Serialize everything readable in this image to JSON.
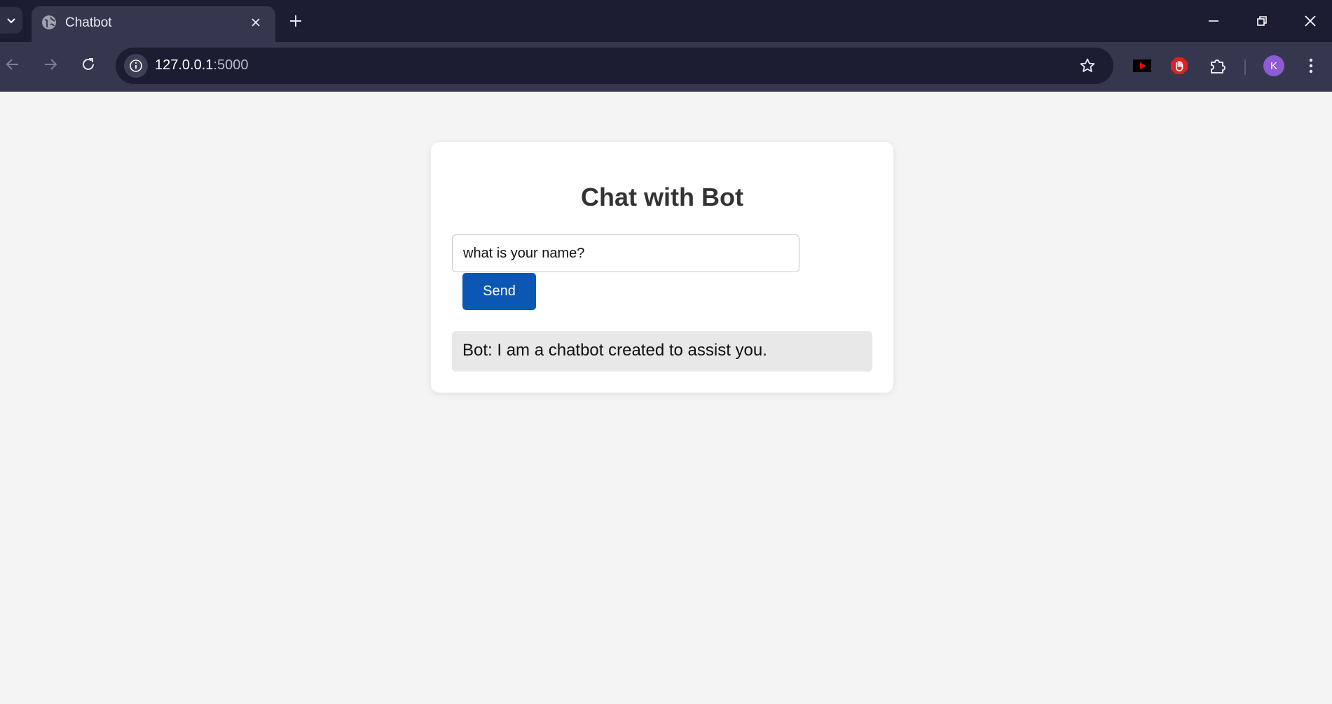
{
  "browser": {
    "tab": {
      "title": "Chatbot",
      "favicon": "globe-icon"
    },
    "address_bar": {
      "host": "127.0.0.1",
      "port": ":5000"
    },
    "profile_initial": "K",
    "colors": {
      "tabstrip": "#1c1d33",
      "toolbar": "#35374f",
      "avatar": "#8e5bd3"
    }
  },
  "chat": {
    "title": "Chat with Bot",
    "input_value": "what is your name?",
    "send_label": "Send",
    "response": "Bot: I am a chatbot created to assist you.",
    "colors": {
      "send_button": "#0b57b3",
      "response_bg": "#e8e8e8",
      "page_bg": "#f4f4f4"
    }
  }
}
